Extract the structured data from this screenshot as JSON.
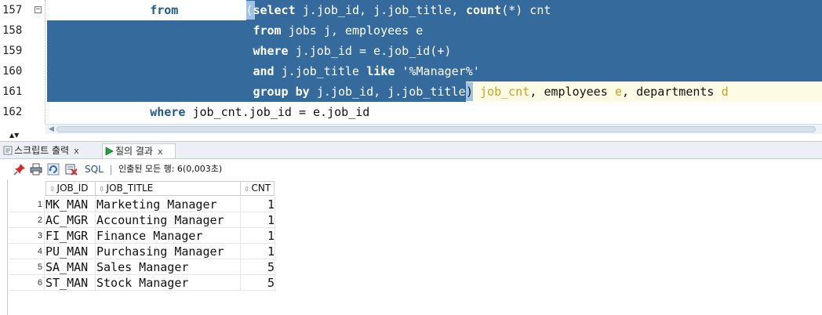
{
  "editor": {
    "lines": [
      {
        "num": "157",
        "indent_kw": "from",
        "selected_tokens": [
          {
            "t": "(",
            "k": "p"
          },
          {
            "t": "select",
            "k": "kw"
          },
          {
            "t": " j.job_id, j.job_title, ",
            "k": "p"
          },
          {
            "t": "count",
            "k": "kw"
          },
          {
            "t": "(*) cnt",
            "k": "p"
          }
        ]
      },
      {
        "num": "158",
        "selected_tokens": [
          {
            "t": "from",
            "k": "kw"
          },
          {
            "t": " jobs j, employees e",
            "k": "p"
          }
        ]
      },
      {
        "num": "159",
        "selected_tokens": [
          {
            "t": "where",
            "k": "kw"
          },
          {
            "t": " j.job_id = e.job_id(+)",
            "k": "p"
          }
        ]
      },
      {
        "num": "160",
        "selected_tokens": [
          {
            "t": "and",
            "k": "kw"
          },
          {
            "t": " j.job_title ",
            "k": "p"
          },
          {
            "t": "like",
            "k": "kw"
          },
          {
            "t": " '%Manager%'",
            "k": "p"
          }
        ]
      },
      {
        "num": "161",
        "selected_tokens": [
          {
            "t": "group by",
            "k": "kw"
          },
          {
            "t": " j.job_id, j.job_title",
            "k": "p"
          }
        ],
        "after_tokens": [
          {
            "t": ")",
            "k": "p"
          },
          {
            "t": " job_cnt",
            "k": "y"
          },
          {
            "t": ", employees ",
            "k": "p"
          },
          {
            "t": "e",
            "k": "y"
          },
          {
            "t": ", departments ",
            "k": "p"
          },
          {
            "t": "d",
            "k": "y"
          }
        ]
      },
      {
        "num": "162",
        "indent_kw": "where",
        "tail": " job_cnt.job_id = e.job_id"
      }
    ]
  },
  "tabs": [
    {
      "label": "스크립트 출력",
      "close": "x",
      "icon": "script-output-icon"
    },
    {
      "label": "질의 결과",
      "close": "x",
      "icon": "run-icon"
    }
  ],
  "toolbar": {
    "sql_label": "SQL",
    "status": "인출된 모든 행: 6(0,003초)"
  },
  "grid": {
    "columns": [
      "JOB_ID",
      "JOB_TITLE",
      "CNT"
    ],
    "rows": [
      {
        "n": "1",
        "job_id": "MK_MAN",
        "job_title": "Marketing Manager",
        "cnt": "1"
      },
      {
        "n": "2",
        "job_id": "AC_MGR",
        "job_title": "Accounting Manager",
        "cnt": "1"
      },
      {
        "n": "3",
        "job_id": "FI_MGR",
        "job_title": "Finance Manager",
        "cnt": "1"
      },
      {
        "n": "4",
        "job_id": "PU_MAN",
        "job_title": "Purchasing Manager",
        "cnt": "1"
      },
      {
        "n": "5",
        "job_id": "SA_MAN",
        "job_title": "Sales Manager",
        "cnt": "5"
      },
      {
        "n": "6",
        "job_id": "ST_MAN",
        "job_title": "Stock Manager",
        "cnt": "5"
      }
    ]
  },
  "colors": {
    "selection": "#356a9c",
    "keyword": "#1f5a8c",
    "identifier": "#c9a227"
  }
}
